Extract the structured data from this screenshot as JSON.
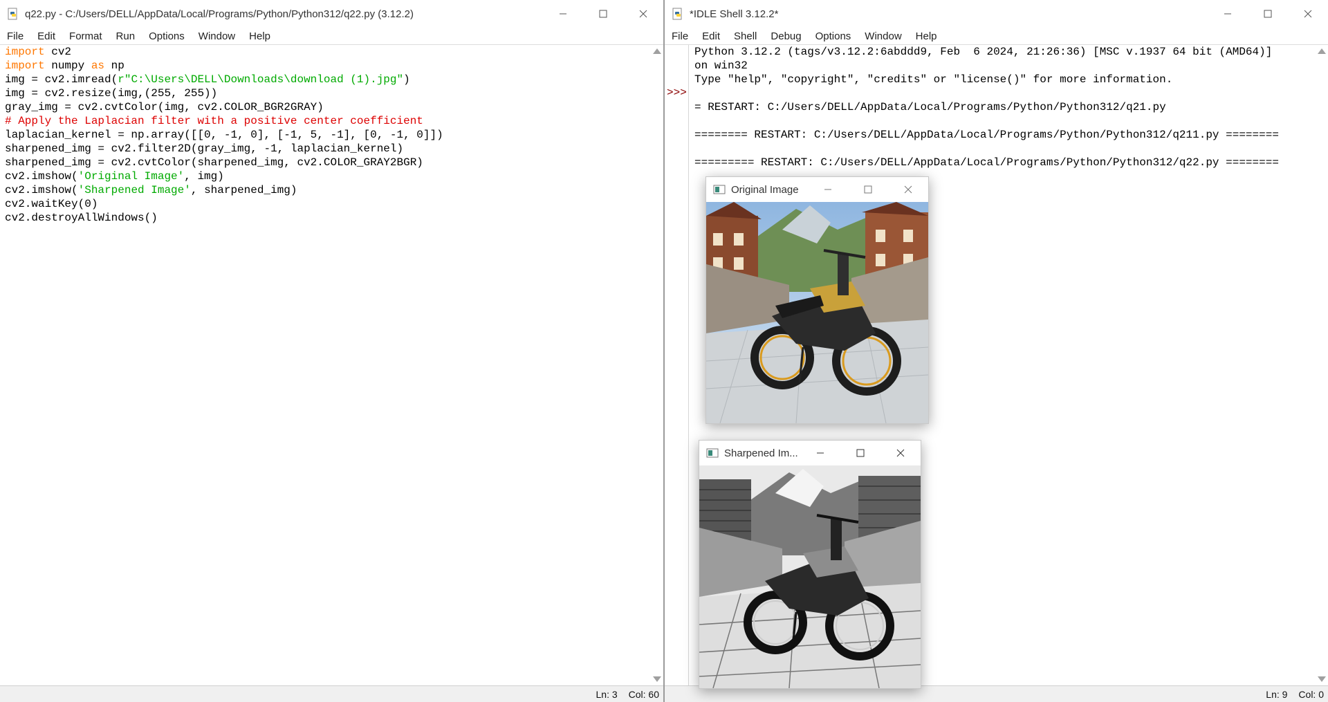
{
  "editor": {
    "title": "q22.py - C:/Users/DELL/AppData/Local/Programs/Python/Python312/q22.py (3.12.2)",
    "menu": [
      "File",
      "Edit",
      "Format",
      "Run",
      "Options",
      "Window",
      "Help"
    ],
    "code": {
      "l1_kw": "import",
      "l1_rest": " cv2",
      "l2_kw": "import",
      "l2_mid": " numpy ",
      "l2_kw2": "as",
      "l2_rest": " np",
      "l3_a": "img = cv2.imread(",
      "l3_str": "r\"C:\\Users\\DELL\\Downloads\\download (1).jpg\"",
      "l3_b": ")",
      "l4": "img = cv2.resize(img,(255, 255))",
      "l5": "gray_img = cv2.cvtColor(img, cv2.COLOR_BGR2GRAY)",
      "l6": "# Apply the Laplacian filter with a positive center coefficient",
      "l7": "laplacian_kernel = np.array([[0, -1, 0], [-1, 5, -1], [0, -1, 0]])",
      "l8": "sharpened_img = cv2.filter2D(gray_img, -1, laplacian_kernel)",
      "l9": "sharpened_img = cv2.cvtColor(sharpened_img, cv2.COLOR_GRAY2BGR)",
      "l10_a": "cv2.imshow(",
      "l10_str": "'Original Image'",
      "l10_b": ", img)",
      "l11_a": "cv2.imshow(",
      "l11_str": "'Sharpened Image'",
      "l11_b": ", sharpened_img)",
      "l12": "cv2.waitKey(0)",
      "l13": "cv2.destroyAllWindows()"
    },
    "status": {
      "ln": "Ln: 3",
      "col": "Col: 60"
    }
  },
  "shell": {
    "title": "*IDLE Shell 3.12.2*",
    "menu": [
      "File",
      "Edit",
      "Shell",
      "Debug",
      "Options",
      "Window",
      "Help"
    ],
    "prompt": ">>>",
    "lines": [
      "Python 3.12.2 (tags/v3.12.2:6abddd9, Feb  6 2024, 21:26:36) [MSC v.1937 64 bit (AMD64)]",
      "on win32",
      "Type \"help\", \"copyright\", \"credits\" or \"license()\" for more information.",
      "",
      "= RESTART: C:/Users/DELL/AppData/Local/Programs/Python/Python312/q21.py",
      "",
      "======== RESTART: C:/Users/DELL/AppData/Local/Programs/Python/Python312/q211.py ========",
      "",
      "========= RESTART: C:/Users/DELL/AppData/Local/Programs/Python/Python312/q22.py ========"
    ],
    "status": {
      "ln": "Ln: 9",
      "col": "Col: 0"
    }
  },
  "original_window": {
    "title": "Original Image"
  },
  "sharpened_window": {
    "title": "Sharpened Im..."
  },
  "colors": {
    "keyword": "#ff7700",
    "string": "#00aa00",
    "comment": "#dd0000",
    "prompt": "#8b0000"
  }
}
